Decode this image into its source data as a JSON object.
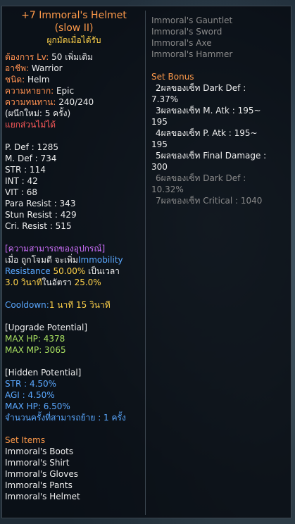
{
  "item": {
    "name": "+7 Immoral's Helmet",
    "subname": "(slow II)",
    "bind": "ผูกมัดเมื่อได้รับ"
  },
  "requirements": {
    "level_label": "ต้องการ Lv:",
    "level_value": "50 เพิ่มเติม",
    "class_label": "อาชีพ:",
    "class_value": "Warrior",
    "type_label": "ชนิด:",
    "type_value": "Helm",
    "rarity_label": "ความหายาก:",
    "rarity_value": "Epic",
    "durability_label": "ความทนทาน:",
    "durability_value": "240/240",
    "seal": "(ผนึกใหม่: 5 ครั้ง)",
    "nodecompose": "แยกส่วนไม่ได้"
  },
  "stats": [
    "P. Def : 1285",
    "M. Def : 734",
    "STR : 114",
    "INT : 42",
    "VIT : 68",
    "Para Resist : 343",
    "Stun Resist : 429",
    "Cri. Resist : 515"
  ],
  "ability": {
    "header": "[ความสามารถของอุปกรณ์]",
    "line1_a": "เมื่อ ถูกโจมตี จะเพิ่ม",
    "line1_b": "Immobility",
    "line2_a": "Resistance ",
    "line2_b": "50.00%",
    "line2_c": " เป็นเวลา",
    "line3_a": "3.0 วินาที",
    "line3_b": "ในอัตรา ",
    "line3_c": "25.0%"
  },
  "cooldown": {
    "label": "Cooldown:",
    "value": "1 นาที 15 วินาที"
  },
  "upgrade": {
    "header": "[Upgrade Potential]",
    "lines": [
      "MAX HP: 4378",
      "MAX MP: 3065"
    ]
  },
  "hidden": {
    "header": "[Hidden Potential]",
    "lines": [
      "STR : 4.50%",
      "AGI : 4.50%",
      "MAX HP: 6.50%"
    ],
    "transfer": "จำนวนครั้งที่สามารถย้าย : 1 ครั้ง"
  },
  "set_items": {
    "header": "Set Items",
    "owned": [
      "Immoral's Boots",
      "Immoral's Shirt",
      "Immoral's Gloves",
      "Immoral's Pants",
      "Immoral's Helmet"
    ],
    "missing": [
      "Immoral's Gauntlet",
      "Immoral's Sword",
      "Immoral's Axe",
      "Immoral's Hammer"
    ]
  },
  "set_bonus": {
    "header": "Set Bonus",
    "active": [
      [
        "2ผลของเซ็ท Dark Def :",
        "7.37%"
      ],
      [
        "3ผลของเซ็ท M. Atk : 195~",
        "195"
      ],
      [
        "4ผลของเซ็ท P. Atk : 195~",
        "195"
      ],
      [
        "5ผลของเซ็ท Final Damage :",
        "300"
      ]
    ],
    "inactive": [
      [
        "6ผลของเซ็ท Dark Def :",
        "10.32%"
      ],
      [
        "7ผลของเซ็ท Critical : 1040"
      ]
    ]
  },
  "colors": {
    "title": "#ff9a4a",
    "label": "#ff9050",
    "ability": "#d070ff",
    "blue": "#5aa8ff",
    "yellow": "#ffd24a",
    "green": "#a8e060",
    "inactive": "#8a8a8a"
  }
}
